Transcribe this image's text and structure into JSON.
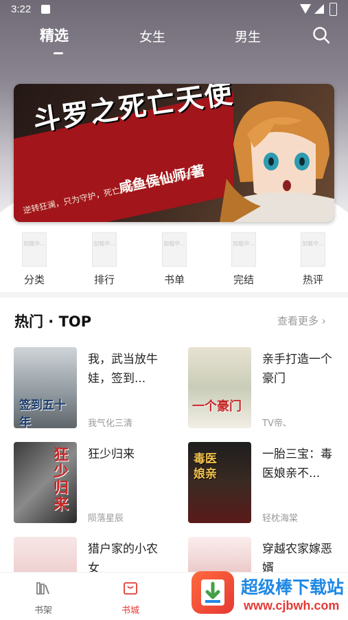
{
  "status_bar": {
    "time": "3:22"
  },
  "tabs": [
    {
      "label": "精选",
      "active": true
    },
    {
      "label": "女生",
      "active": false
    },
    {
      "label": "男生",
      "active": false
    }
  ],
  "banner": {
    "title": "斗罗之死亡天使",
    "author": "咸鱼侯仙师/著",
    "tagline": "逆转狂澜，只为守护，死亡的另外一层含义为守护"
  },
  "quick_entries": [
    {
      "label": "分类",
      "thumb_text": "加载中..."
    },
    {
      "label": "排行",
      "thumb_text": "加载中..."
    },
    {
      "label": "书单",
      "thumb_text": "加载中..."
    },
    {
      "label": "完结",
      "thumb_text": "加载中..."
    },
    {
      "label": "热评",
      "thumb_text": "加载中..."
    }
  ],
  "section": {
    "title": "热门 · TOP",
    "more": "查看更多"
  },
  "books": [
    {
      "title": "我，武当放牛娃，签到...",
      "author": "我气化三清",
      "cover_text": "签到五十年"
    },
    {
      "title": "亲手打造一个豪门",
      "author": "TV帝、",
      "cover_text": "一个豪门"
    },
    {
      "title": "狂少归来",
      "author": "陨落星辰",
      "cover_text": "狂少归来"
    },
    {
      "title": "一胎三宝：毒医娘亲不...",
      "author": "轻枕海棠",
      "cover_text": "毒医娘亲"
    },
    {
      "title": "猎户家的小农女",
      "author": "",
      "cover_text": ""
    },
    {
      "title": "穿越农家嫁恶婿",
      "author": "",
      "cover_text": ""
    }
  ],
  "bottom_nav": [
    {
      "label": "书架",
      "active": false
    },
    {
      "label": "书城",
      "active": true
    }
  ],
  "watermark": {
    "text": "超级棒下载站",
    "url": "www.cjbwh.com"
  },
  "colors": {
    "accent": "#e53935",
    "banner_red": "#a2151a"
  }
}
